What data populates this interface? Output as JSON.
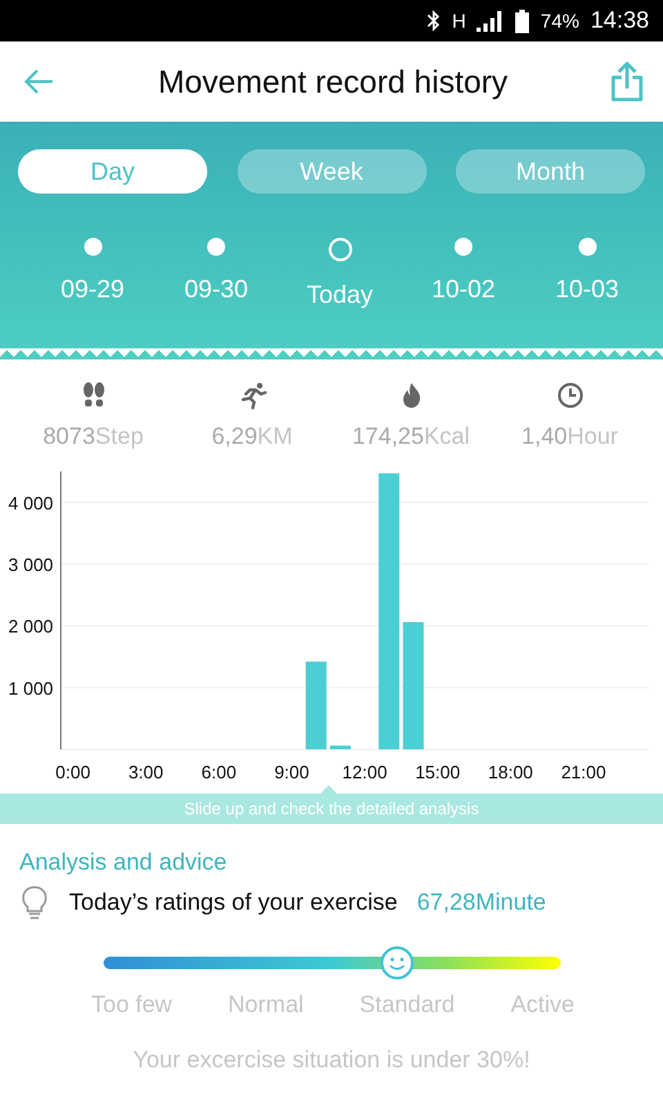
{
  "status_bar": {
    "network": "H",
    "battery": "74%",
    "time": "14:38"
  },
  "app_bar": {
    "title": "Movement record history"
  },
  "tabs": [
    {
      "label": "Day",
      "selected": true
    },
    {
      "label": "Week",
      "selected": false
    },
    {
      "label": "Month",
      "selected": false
    }
  ],
  "dates": [
    {
      "label": "09-29",
      "selected": false
    },
    {
      "label": "09-30",
      "selected": false
    },
    {
      "label": "Today",
      "selected": true
    },
    {
      "label": "10-02",
      "selected": false
    },
    {
      "label": "10-03",
      "selected": false
    }
  ],
  "stats": [
    {
      "value": "8073",
      "unit": "Step"
    },
    {
      "value": "6,29",
      "unit": "KM"
    },
    {
      "value": "174,25",
      "unit": "Kcal"
    },
    {
      "value": "1,40",
      "unit": "Hour"
    }
  ],
  "chart_data": {
    "type": "bar",
    "grid": true,
    "x": [
      0,
      1,
      2,
      3,
      4,
      5,
      6,
      7,
      8,
      9,
      10,
      11,
      12,
      13,
      14,
      15,
      16,
      17,
      18,
      19,
      20,
      21,
      22,
      23
    ],
    "xlim": [
      -0.5,
      23.7
    ],
    "series": [
      {
        "color": "#4ccfd4",
        "values": [
          0,
          0,
          0,
          0,
          0,
          0,
          0,
          0,
          0,
          0,
          1420,
          60,
          0,
          4470,
          2060,
          0,
          0,
          0,
          0,
          0,
          0,
          0,
          0,
          0
        ]
      }
    ],
    "ylim": [
      0,
      4500
    ],
    "yticks": [
      {
        "value": 1000,
        "label": "1 000"
      },
      {
        "value": 2000,
        "label": "2 000"
      },
      {
        "value": 3000,
        "label": "3 000"
      },
      {
        "value": 4000,
        "label": "4 000"
      }
    ],
    "xticks": [
      {
        "value": 0,
        "label": "0:00"
      },
      {
        "value": 3,
        "label": "3:00"
      },
      {
        "value": 6,
        "label": "6:00"
      },
      {
        "value": 9,
        "label": "9:00"
      },
      {
        "value": 12,
        "label": "12:00"
      },
      {
        "value": 15,
        "label": "15:00"
      },
      {
        "value": 18,
        "label": "18:00"
      },
      {
        "value": 21,
        "label": "21:00"
      }
    ]
  },
  "hint": "Slide up and check the detailed analysis",
  "analysis": {
    "title": "Analysis and advice",
    "rating_label": "Today’s ratings of your exercise",
    "rating_value": "67,28Minute",
    "level": 0.64,
    "scale": [
      "Too few",
      "Normal",
      "Standard",
      "Active"
    ],
    "message": "Your excercise situation is under 30%!"
  }
}
